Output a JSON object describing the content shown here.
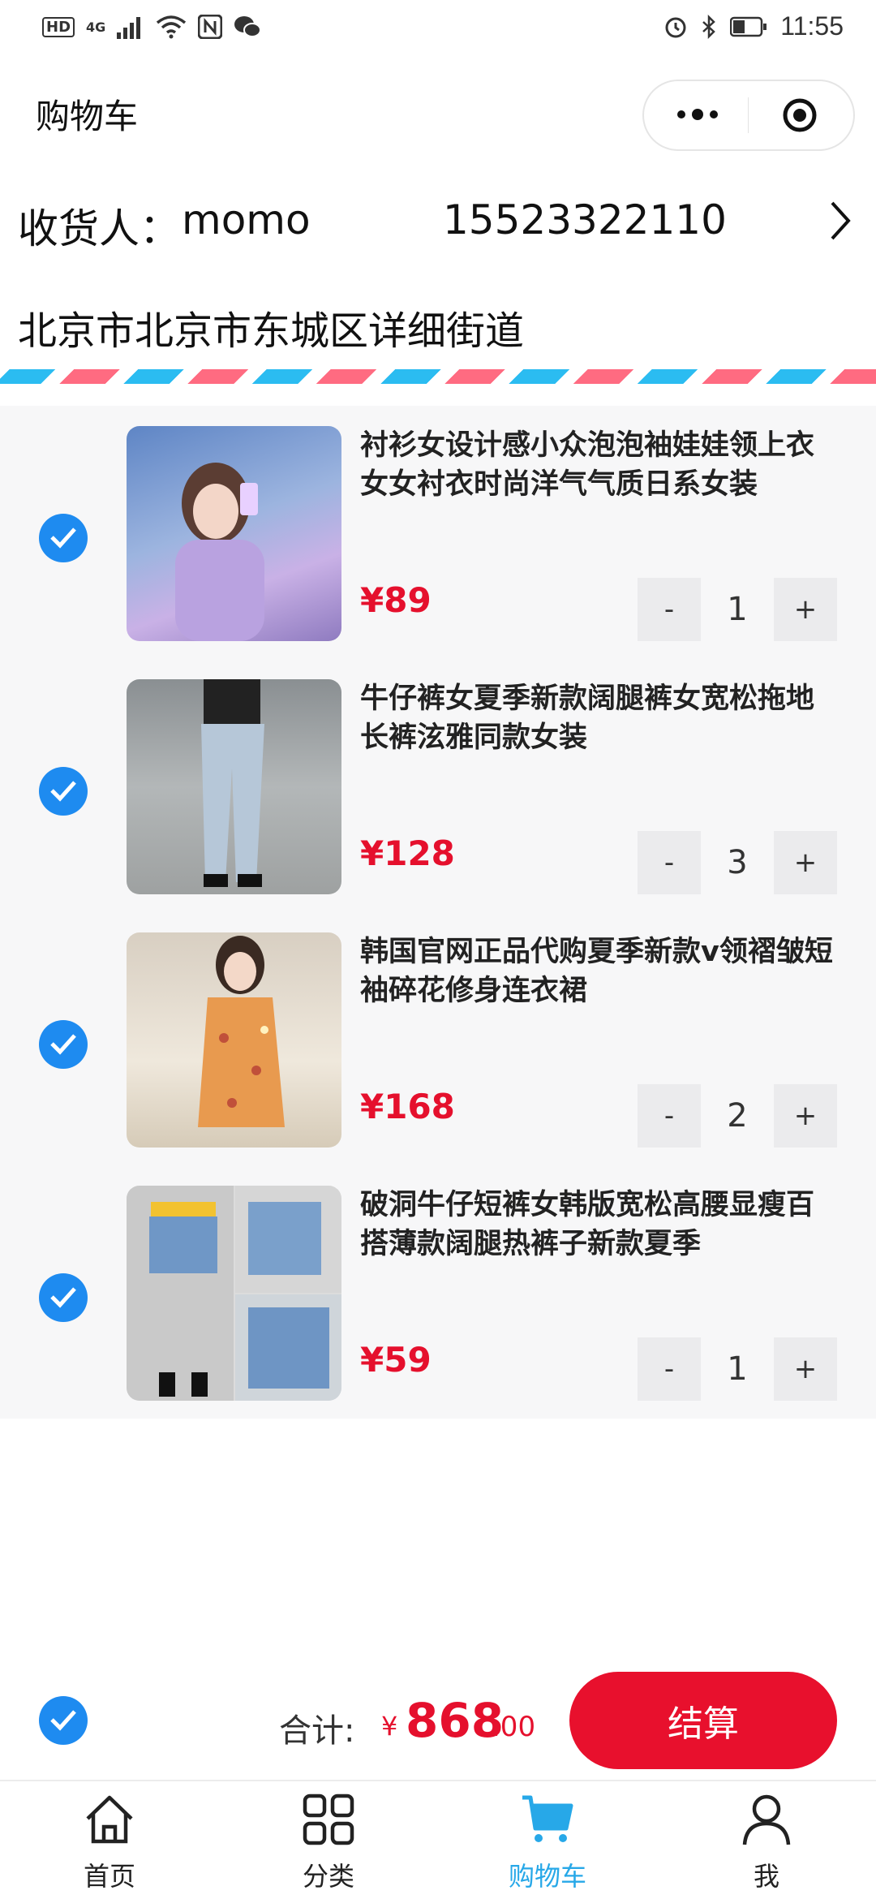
{
  "status_bar": {
    "left": [
      "HD",
      "4G"
    ],
    "time": "11:55"
  },
  "header": {
    "title": "购物车"
  },
  "address": {
    "receiver_label": "收货人：",
    "receiver_name": "momo",
    "phone": "15523322110",
    "address_line": "北京市北京市东城区详细街道"
  },
  "cart": {
    "items": [
      {
        "title": "衬衫女设计感小众泡泡袖娃娃领上衣女女衬衣时尚洋气气质日系女装",
        "price": "¥89",
        "quantity": "1",
        "checked": true
      },
      {
        "title": "牛仔裤女夏季新款阔腿裤女宽松拖地长裤泫雅同款女装",
        "price": "¥128",
        "quantity": "3",
        "checked": true
      },
      {
        "title": "韩国官网正品代购夏季新款v领褶皱短袖碎花修身连衣裙",
        "price": "¥168",
        "quantity": "2",
        "checked": true
      },
      {
        "title": "破洞牛仔短裤女韩版宽松高腰显瘦百搭薄款阔腿热裤子新款夏季",
        "price": "¥59",
        "quantity": "1",
        "checked": true
      }
    ],
    "minus_label": "-",
    "plus_label": "+"
  },
  "footer": {
    "total_label": "合计:",
    "currency": "¥",
    "total_integer": "868",
    "total_decimal": ".00",
    "checkout_label": "结算"
  },
  "tabbar": {
    "tabs": [
      {
        "label": "首页",
        "icon": "home-icon",
        "active": false
      },
      {
        "label": "分类",
        "icon": "category-icon",
        "active": false
      },
      {
        "label": "购物车",
        "icon": "cart-icon",
        "active": true
      },
      {
        "label": "我",
        "icon": "user-icon",
        "active": false
      }
    ]
  },
  "colors": {
    "accent_blue": "#1e8bf0",
    "price_red": "#e5102d",
    "checkout_red": "#e8102d",
    "active_tab": "#27a8e8"
  }
}
